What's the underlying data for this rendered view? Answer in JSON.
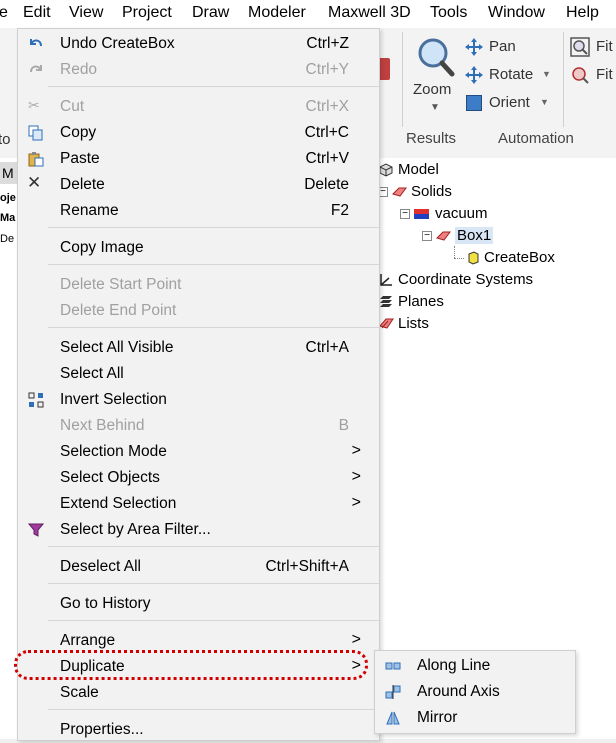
{
  "menubar": {
    "items": [
      "e",
      "Edit",
      "View",
      "Project",
      "Draw",
      "Modeler",
      "Maxwell 3D",
      "Tools",
      "Window",
      "Help"
    ]
  },
  "ribbon": {
    "zoom_label": "Zoom",
    "pan_label": "Pan",
    "rotate_label": "Rotate",
    "orient_label": "Orient",
    "fit1_label": "Fit",
    "fit2_label": "Fit",
    "results_label": "Results",
    "automation_label": "Automation",
    "stub_to": "to"
  },
  "leftpanel": {
    "stub1": "M",
    "stub2": "oje",
    "stub3": "Ma",
    "stub4": "De"
  },
  "tree": {
    "model": "Model",
    "solids": "Solids",
    "vacuum": "vacuum",
    "box1": "Box1",
    "createbox": "CreateBox",
    "coordinate_systems": "Coordinate Systems",
    "planes": "Planes",
    "lists": "Lists"
  },
  "menu": {
    "undo": {
      "label": "Undo CreateBox",
      "shortcut": "Ctrl+Z"
    },
    "redo": {
      "label": "Redo",
      "shortcut": "Ctrl+Y"
    },
    "cut": {
      "label": "Cut",
      "shortcut": "Ctrl+X"
    },
    "copy": {
      "label": "Copy",
      "shortcut": "Ctrl+C"
    },
    "paste": {
      "label": "Paste",
      "shortcut": "Ctrl+V"
    },
    "delete": {
      "label": "Delete",
      "shortcut": "Delete"
    },
    "rename": {
      "label": "Rename",
      "shortcut": "F2"
    },
    "copy_image": {
      "label": "Copy Image"
    },
    "delete_start_point": {
      "label": "Delete Start Point"
    },
    "delete_end_point": {
      "label": "Delete End Point"
    },
    "select_all_visible": {
      "label": "Select All Visible",
      "shortcut": "Ctrl+A"
    },
    "select_all": {
      "label": "Select All"
    },
    "invert_selection": {
      "label": "Invert Selection"
    },
    "next_behind": {
      "label": "Next Behind",
      "shortcut": "B"
    },
    "selection_mode": {
      "label": "Selection Mode",
      "arrow": ">"
    },
    "select_objects": {
      "label": "Select Objects",
      "arrow": ">"
    },
    "extend_selection": {
      "label": "Extend Selection",
      "arrow": ">"
    },
    "select_by_area_filter": {
      "label": "Select by Area Filter..."
    },
    "deselect_all": {
      "label": "Deselect All",
      "shortcut": "Ctrl+Shift+A"
    },
    "go_to_history": {
      "label": "Go to History"
    },
    "arrange": {
      "label": "Arrange",
      "arrow": ">"
    },
    "duplicate": {
      "label": "Duplicate",
      "arrow": ">"
    },
    "scale": {
      "label": "Scale"
    },
    "properties": {
      "label": "Properties..."
    }
  },
  "submenu": {
    "along_line": "Along Line",
    "around_axis": "Around Axis",
    "mirror": "Mirror"
  },
  "colors": {
    "highlight": "#d40000",
    "menu_bg": "#f2f2f2",
    "disabled_text": "#a0a0a0"
  }
}
